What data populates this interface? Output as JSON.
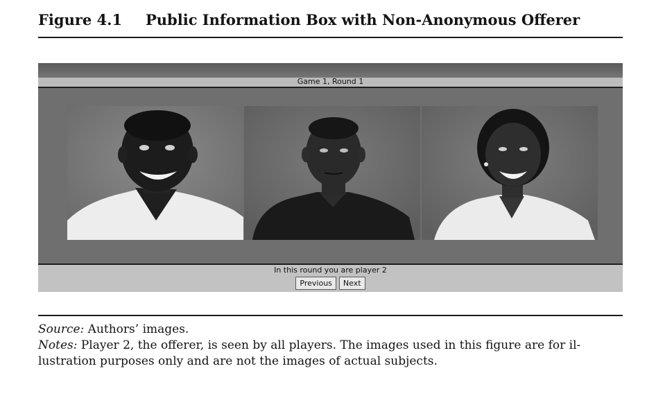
{
  "figure": {
    "number": "Figure 4.1",
    "title": "Public Information Box with Non-Anonymous Offerer"
  },
  "app": {
    "game_label": "Game 1, Round 1",
    "round_message": "In this round you are player 2",
    "buttons": {
      "previous": "Previous",
      "next": "Next"
    },
    "photos": [
      "player-1-photo",
      "player-2-photo",
      "player-3-photo"
    ]
  },
  "notes": {
    "source_label": "Source:",
    "source_text": " Authors’ images.",
    "notes_label": "Notes:",
    "notes_line1": " Player 2, the offerer, is seen by all players. The images used in this figure are for il-",
    "notes_line2": "lustration purposes only and are not the images of actual subjects."
  }
}
